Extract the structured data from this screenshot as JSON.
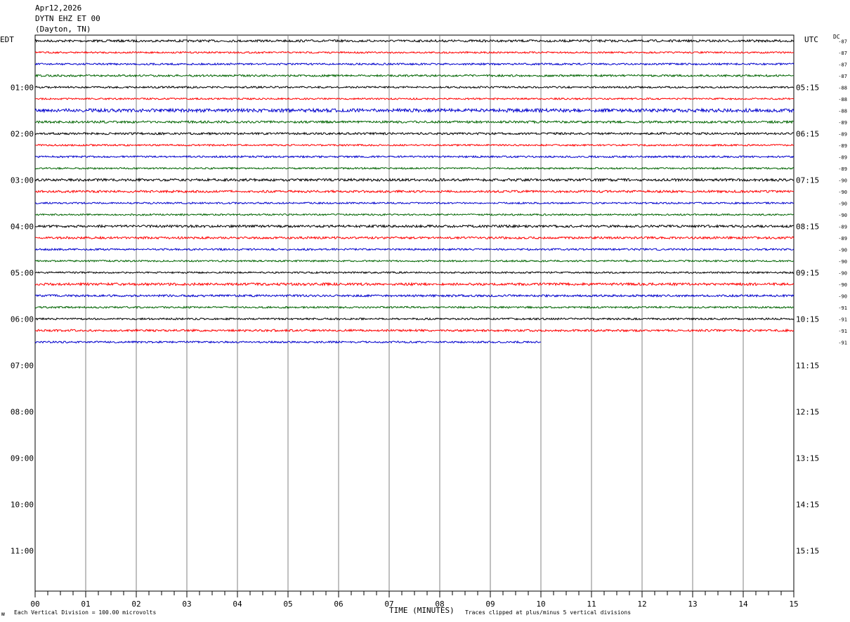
{
  "header": {
    "date": "Apr12,2026",
    "station": "DYTN EHZ ET 00",
    "location": "(Dayton, TN)"
  },
  "left_label": "EDT",
  "right_label": "UTC",
  "dc_label": "DC",
  "footer": {
    "scale": "Each Vertical Division =  100.00 microvolts",
    "xlabel": "TIME (MINUTES)",
    "clip": "Traces clipped at plus/minus 5 vertical divisions",
    "corner": "ᴍ"
  },
  "chart_data": {
    "type": "line",
    "title": "",
    "xlabel": "TIME (MINUTES)",
    "ylabel": "",
    "xlim": [
      0,
      15
    ],
    "x_ticks": [
      "00",
      "01",
      "02",
      "03",
      "04",
      "05",
      "06",
      "07",
      "08",
      "09",
      "10",
      "11",
      "12",
      "13",
      "14",
      "15"
    ],
    "grid": true,
    "rows_per_hour": 4,
    "total_rows": 48,
    "left_hour_labels": [
      "01:00",
      "02:00",
      "03:00",
      "04:00",
      "05:00",
      "06:00",
      "07:00",
      "08:00",
      "09:00",
      "10:00",
      "11:00"
    ],
    "right_hour_labels": [
      "05:15",
      "06:15",
      "07:15",
      "08:15",
      "09:15",
      "10:15",
      "11:15",
      "12:15",
      "13:15",
      "14:15",
      "15:15"
    ],
    "trace_colors": [
      "#000000",
      "#ff0000",
      "#0000cc",
      "#006400"
    ],
    "traces": [
      {
        "row": 0,
        "dc": -87,
        "end_minute": 15,
        "amp": 1.6
      },
      {
        "row": 1,
        "dc": -87,
        "end_minute": 15,
        "amp": 1.2
      },
      {
        "row": 2,
        "dc": -87,
        "end_minute": 15,
        "amp": 1.3
      },
      {
        "row": 3,
        "dc": -87,
        "end_minute": 15,
        "amp": 1.4
      },
      {
        "row": 4,
        "dc": -88,
        "end_minute": 15,
        "amp": 1.3
      },
      {
        "row": 5,
        "dc": -88,
        "end_minute": 15,
        "amp": 1.2
      },
      {
        "row": 6,
        "dc": -88,
        "end_minute": 15,
        "amp": 2.4
      },
      {
        "row": 7,
        "dc": -89,
        "end_minute": 15,
        "amp": 1.6
      },
      {
        "row": 8,
        "dc": -89,
        "end_minute": 15,
        "amp": 1.5
      },
      {
        "row": 9,
        "dc": -89,
        "end_minute": 15,
        "amp": 1.2
      },
      {
        "row": 10,
        "dc": -89,
        "end_minute": 15,
        "amp": 1.3
      },
      {
        "row": 11,
        "dc": -89,
        "end_minute": 15,
        "amp": 1.2
      },
      {
        "row": 12,
        "dc": -90,
        "end_minute": 15,
        "amp": 1.8
      },
      {
        "row": 13,
        "dc": -90,
        "end_minute": 15,
        "amp": 1.6
      },
      {
        "row": 14,
        "dc": -90,
        "end_minute": 15,
        "amp": 1.2
      },
      {
        "row": 15,
        "dc": -90,
        "end_minute": 15,
        "amp": 1.2
      },
      {
        "row": 16,
        "dc": -89,
        "end_minute": 15,
        "amp": 1.7
      },
      {
        "row": 17,
        "dc": -89,
        "end_minute": 15,
        "amp": 1.6
      },
      {
        "row": 18,
        "dc": -90,
        "end_minute": 15,
        "amp": 1.3
      },
      {
        "row": 19,
        "dc": -90,
        "end_minute": 15,
        "amp": 1.2
      },
      {
        "row": 20,
        "dc": -90,
        "end_minute": 15,
        "amp": 1.2
      },
      {
        "row": 21,
        "dc": -90,
        "end_minute": 15,
        "amp": 1.8
      },
      {
        "row": 22,
        "dc": -90,
        "end_minute": 15,
        "amp": 1.5
      },
      {
        "row": 23,
        "dc": -91,
        "end_minute": 15,
        "amp": 1.3
      },
      {
        "row": 24,
        "dc": -91,
        "end_minute": 15,
        "amp": 1.3
      },
      {
        "row": 25,
        "dc": -91,
        "end_minute": 15,
        "amp": 1.5
      },
      {
        "row": 26,
        "dc": -91,
        "end_minute": 10,
        "amp": 1.3
      }
    ]
  }
}
